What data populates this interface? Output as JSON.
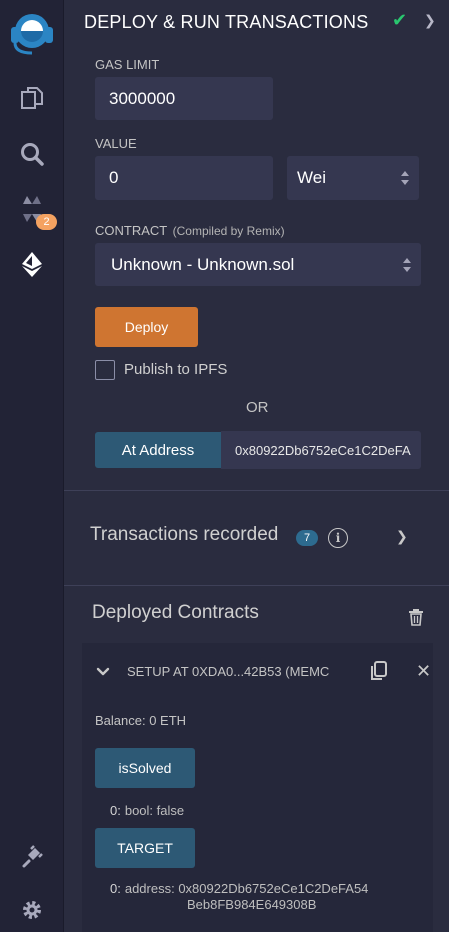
{
  "header": {
    "title": "DEPLOY & RUN TRANSACTIONS"
  },
  "sidebar": {
    "compiler_badge": "2"
  },
  "form": {
    "gas_limit_label": "GAS LIMIT",
    "gas_limit_value": "3000000",
    "value_label": "VALUE",
    "value_amount": "0",
    "value_unit": "Wei",
    "contract_label": "CONTRACT",
    "contract_sublabel": "(Compiled by Remix)",
    "contract_selected": "Unknown - Unknown.sol",
    "deploy_label": "Deploy",
    "publish_label": "Publish to IPFS",
    "or_label": "OR",
    "at_address_label": "At Address",
    "at_address_value": "0x80922Db6752eCe1C2DeFA"
  },
  "transactions": {
    "label": "Transactions recorded",
    "count": "7"
  },
  "deployed": {
    "label": "Deployed Contracts",
    "instance": {
      "title": "SETUP AT 0XDA0...42B53 (MEMC",
      "balance": "Balance: 0 ETH",
      "functions": [
        {
          "label": "isSolved",
          "output_index": "0:",
          "output": "bool: false"
        },
        {
          "label": "TARGET",
          "output_index": "0:",
          "output_line1": "address: 0x80922Db6752eCe1C2DeFA54",
          "output_line2": "Beb8FB984E649308B"
        }
      ]
    }
  },
  "colors": {
    "accent": "#cf7531",
    "button_blue": "#2d5975",
    "check_green": "#29c76f",
    "badge_orange": "#f4a261",
    "panel_bg": "#2a2c3f",
    "rail_bg": "#222336"
  }
}
